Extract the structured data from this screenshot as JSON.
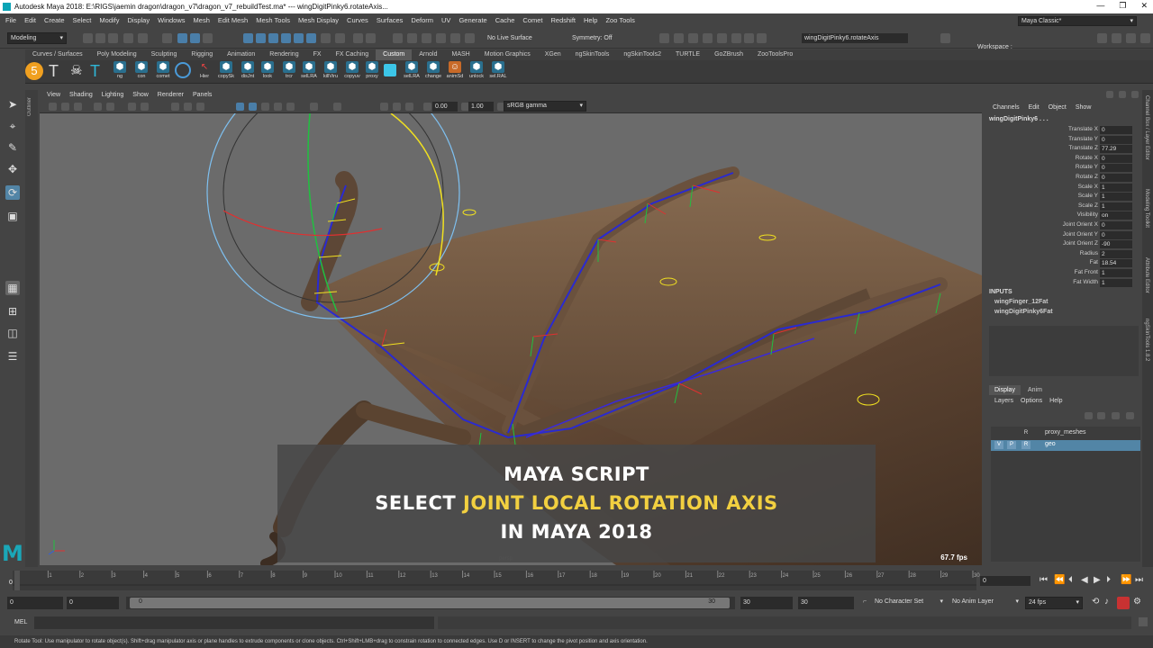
{
  "window": {
    "title": "Autodesk Maya 2018: E:\\RIGS\\jaemin dragon\\dragon_v7\\dragon_v7_rebuildTest.ma*   ---   wingDigitPinky6.rotateAxis...",
    "ctrl_min": "—",
    "ctrl_max": "❐",
    "ctrl_close": "✕"
  },
  "menus": [
    "File",
    "Edit",
    "Create",
    "Select",
    "Modify",
    "Display",
    "Windows",
    "Mesh",
    "Edit Mesh",
    "Mesh Tools",
    "Mesh Display",
    "Curves",
    "Surfaces",
    "Deform",
    "UV",
    "Generate",
    "Cache",
    "Comet",
    "Redshift",
    "Help",
    "Zoo Tools"
  ],
  "toolbar": {
    "mode": "Modeling",
    "live_surface": "No Live Surface",
    "symmetry": "Symmetry: Off",
    "name_field": "wingDigitPinky6.rotateAxis",
    "workspace_label": "Workspace :",
    "workspace": "Maya Classic*"
  },
  "shelf_tabs": [
    "Curves / Surfaces",
    "Poly Modeling",
    "Sculpting",
    "Rigging",
    "Animation",
    "Rendering",
    "FX",
    "FX Caching",
    "Custom",
    "Arnold",
    "MASH",
    "Motion Graphics",
    "XGen",
    "ngSkinTools",
    "ngSkinTools2",
    "TURTLE",
    "GoZBrush",
    "ZooToolsPro"
  ],
  "active_shelf": "Custom",
  "shelf_buttons": [
    "ng",
    "con",
    "comet",
    "",
    "Hier",
    "copySk",
    "disJnt",
    "look",
    "trcr",
    "selLRA",
    "killViru",
    "copyuv",
    "proxy",
    "",
    "selLRA",
    "change",
    "animSd",
    "unlock",
    "sel.RAL"
  ],
  "outliner_label": "Outliner",
  "viewport": {
    "menus": [
      "View",
      "Shading",
      "Lighting",
      "Show",
      "Renderer",
      "Panels"
    ],
    "value1": "0.00",
    "value2": "1.00",
    "color_space": "sRGB gamma",
    "camera": "persp",
    "fps": "67.7 fps"
  },
  "overlay": {
    "line1": "MAYA SCRIPT",
    "line2_pre": "SELECT",
    "line2_hl": "JOINT LOCAL ROTATION AXIS",
    "line3": "IN MAYA 2018"
  },
  "channel_box": {
    "menus": [
      "Channels",
      "Edit",
      "Object",
      "Show"
    ],
    "object": "wingDigitPinky6 . . .",
    "attrs": [
      {
        "name": "Translate X",
        "value": "0"
      },
      {
        "name": "Translate Y",
        "value": "0"
      },
      {
        "name": "Translate Z",
        "value": "77.29"
      },
      {
        "name": "Rotate X",
        "value": "0"
      },
      {
        "name": "Rotate Y",
        "value": "0"
      },
      {
        "name": "Rotate Z",
        "value": "0"
      },
      {
        "name": "Scale X",
        "value": "1"
      },
      {
        "name": "Scale Y",
        "value": "1"
      },
      {
        "name": "Scale Z",
        "value": "1"
      },
      {
        "name": "Visibility",
        "value": "on"
      },
      {
        "name": "Joint Orient X",
        "value": "0"
      },
      {
        "name": "Joint Orient Y",
        "value": "0"
      },
      {
        "name": "Joint Orient Z",
        "value": "-90"
      },
      {
        "name": "Radius",
        "value": "2"
      },
      {
        "name": "Fat",
        "value": "18.54"
      },
      {
        "name": "Fat Front",
        "value": "1"
      },
      {
        "name": "Fat Width",
        "value": "1"
      }
    ],
    "inputs_label": "INPUTS",
    "inputs": [
      "wingFinger_12Fat",
      "wingDigitPinky6Fat"
    ]
  },
  "side_tabs": [
    "Channel Box / Layer Editor",
    "Modeling Toolkit",
    "Attribute Editor",
    "ngSkinTools 1.8.2"
  ],
  "layer_editor": {
    "tabs": [
      "Display",
      "Anim"
    ],
    "menus": [
      "Layers",
      "Options",
      "Help"
    ],
    "layers": [
      {
        "name": "proxy_meshes",
        "flags": [
          "",
          "",
          "R"
        ],
        "selected": false
      },
      {
        "name": "geo",
        "flags": [
          "V",
          "P",
          "R"
        ],
        "selected": true
      }
    ]
  },
  "timeline": {
    "ticks": [
      "1",
      "2",
      "3",
      "4",
      "5",
      "6",
      "7",
      "8",
      "9",
      "10",
      "11",
      "12",
      "13",
      "14",
      "15",
      "16",
      "17",
      "18",
      "19",
      "20",
      "21",
      "22",
      "23",
      "24",
      "25",
      "26",
      "27",
      "28",
      "29",
      "30"
    ],
    "current_frame": "0",
    "frame_field": "0"
  },
  "range": {
    "start": "0",
    "playback_start": "0",
    "slider_start": "0",
    "slider_end": "30",
    "playback_end": "30",
    "end": "30",
    "character_set": "No Character Set",
    "anim_layer": "No Anim Layer",
    "fps": "24 fps"
  },
  "command_line": {
    "label": "MEL"
  },
  "help_line": "Rotate Tool: Use manipulator to rotate object(s). Shift+drag manipulator axis or plane handles to extrude components or clone objects. Ctrl+Shift+LMB+drag to constrain rotation to connected edges. Use D or INSERT to change the pivot position and axis orientation.",
  "colors": {
    "ui_bg": "#444444",
    "viewport_bg": "#6b6b6b",
    "accent": "#5285a6",
    "overlay_highlight": "#f2d040",
    "maya_teal": "#1aa7b8"
  }
}
